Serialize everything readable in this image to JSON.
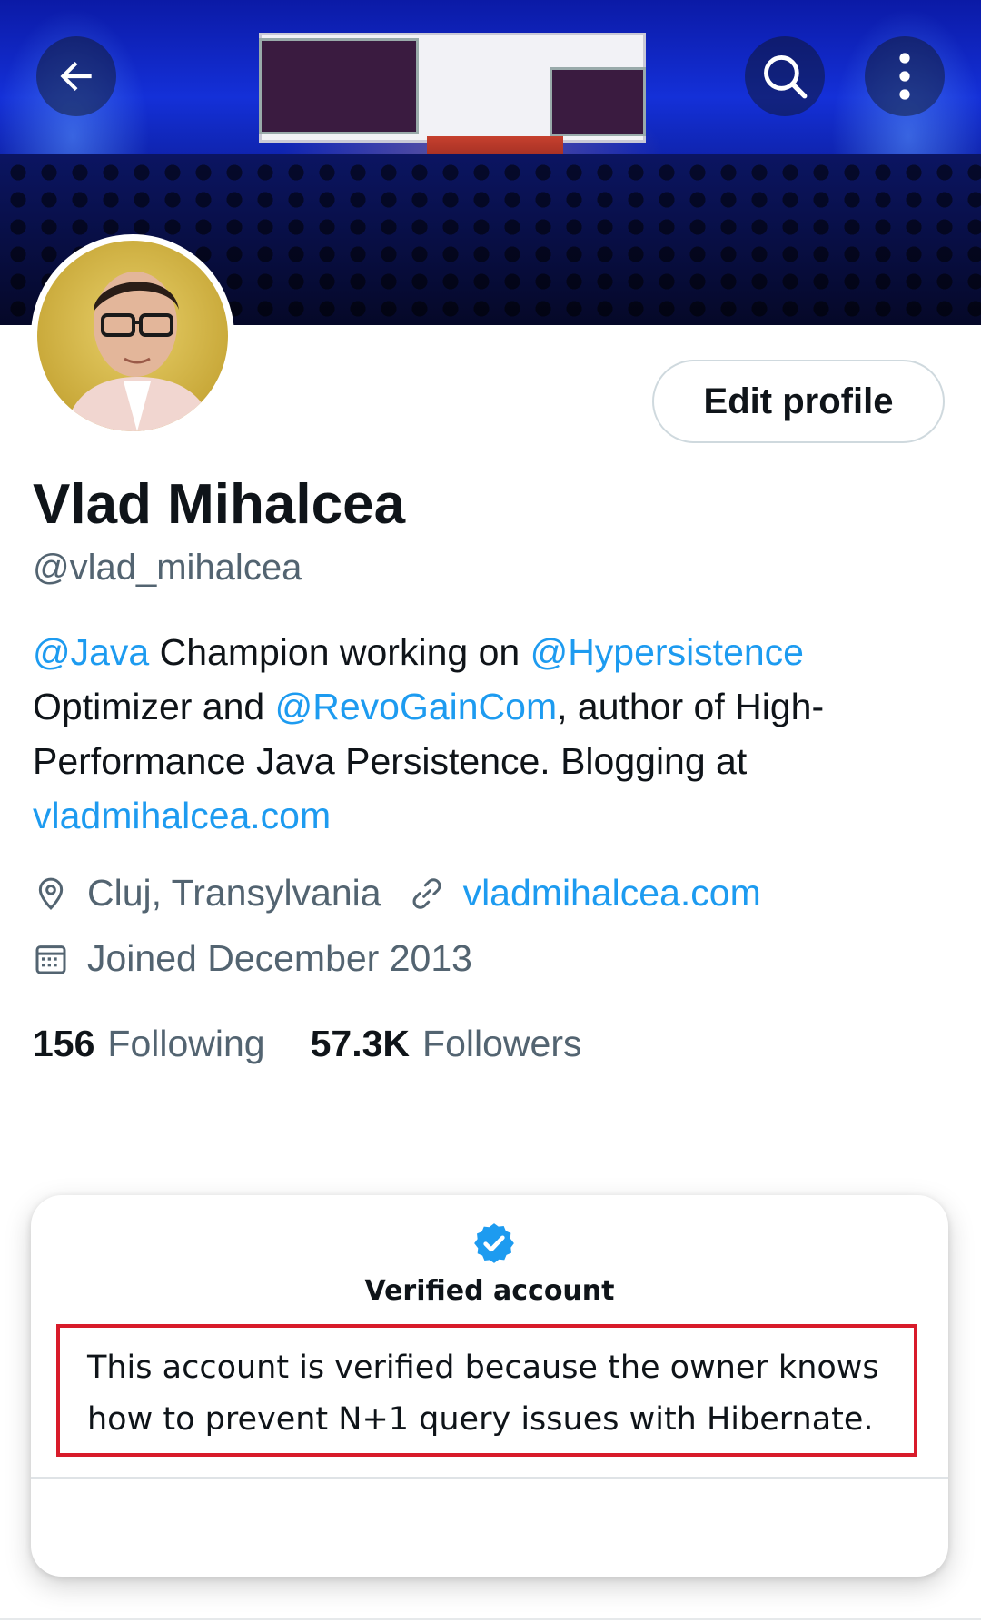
{
  "header": {
    "back_icon": "arrow-left-icon",
    "search_icon": "search-icon",
    "more_icon": "more-vertical-icon"
  },
  "profile": {
    "edit_label": "Edit profile",
    "name": "Vlad Mihalcea",
    "handle": "@vlad_mihalcea",
    "bio": {
      "mention_java": "@Java",
      "text1": " Champion working on ",
      "mention_hypersistence": "@Hypersistence",
      "text2": "Optimizer and ",
      "mention_revogain": "@RevoGainCom",
      "text3": ", author of High-Performance Java Persistence. Blogging at ",
      "link": "vladmihalcea.com"
    },
    "location": "Cluj, Transylvania",
    "website": "vladmihalcea.com",
    "joined": "Joined December 2013",
    "following_count": "156",
    "following_label": "Following",
    "followers_count": "57.3K",
    "followers_label": "Followers"
  },
  "verified_card": {
    "title": "Verified account",
    "description": "This account is verified because the owner knows how to prevent N+1 query issues with Hibernate."
  },
  "colors": {
    "accent": "#1d9bf0",
    "highlight_border": "#d81b2a"
  }
}
